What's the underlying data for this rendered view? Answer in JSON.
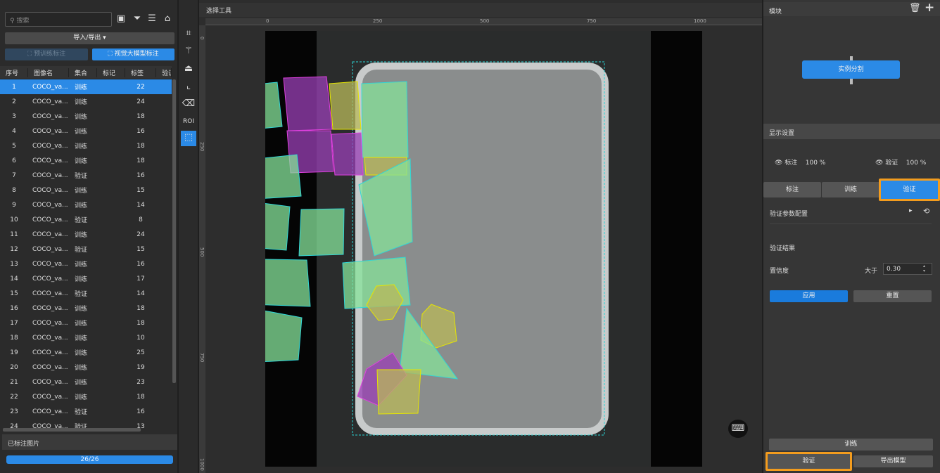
{
  "left_panel": {
    "search_placeholder": "搜索",
    "import_export": "导入/导出 ▾",
    "pretrain_label": "预训练标注",
    "vlm_label": "视觉大模型标注",
    "columns": [
      "序号",
      "图像名",
      "集合",
      "标记",
      "标签",
      "验证"
    ],
    "rows": [
      [
        "1",
        "COCO_va...",
        "训练",
        "",
        "22"
      ],
      [
        "2",
        "COCO_va...",
        "训练",
        "",
        "24"
      ],
      [
        "3",
        "COCO_va...",
        "训练",
        "",
        "18"
      ],
      [
        "4",
        "COCO_va...",
        "训练",
        "",
        "16"
      ],
      [
        "5",
        "COCO_va...",
        "训练",
        "",
        "18"
      ],
      [
        "6",
        "COCO_va...",
        "训练",
        "",
        "18"
      ],
      [
        "7",
        "COCO_va...",
        "验证",
        "",
        "16"
      ],
      [
        "8",
        "COCO_va...",
        "训练",
        "",
        "15"
      ],
      [
        "9",
        "COCO_va...",
        "训练",
        "",
        "14"
      ],
      [
        "10",
        "COCO_va...",
        "验证",
        "",
        "8"
      ],
      [
        "11",
        "COCO_va...",
        "训练",
        "",
        "24"
      ],
      [
        "12",
        "COCO_va...",
        "验证",
        "",
        "15"
      ],
      [
        "13",
        "COCO_va...",
        "训练",
        "",
        "16"
      ],
      [
        "14",
        "COCO_va...",
        "训练",
        "",
        "17"
      ],
      [
        "15",
        "COCO_va...",
        "验证",
        "",
        "14"
      ],
      [
        "16",
        "COCO_va...",
        "训练",
        "",
        "18"
      ],
      [
        "17",
        "COCO_va...",
        "训练",
        "",
        "18"
      ],
      [
        "18",
        "COCO_va...",
        "训练",
        "",
        "10"
      ],
      [
        "19",
        "COCO_va...",
        "训练",
        "",
        "25"
      ],
      [
        "20",
        "COCO_va...",
        "训练",
        "",
        "19"
      ],
      [
        "21",
        "COCO_va...",
        "训练",
        "",
        "23"
      ],
      [
        "22",
        "COCO_va...",
        "训练",
        "",
        "18"
      ],
      [
        "23",
        "COCO_va...",
        "验证",
        "",
        "16"
      ],
      [
        "24",
        "COCO_va...",
        "验证",
        "",
        "13"
      ]
    ],
    "selected_row": 0,
    "annotated_title": "已标注图片",
    "progress_text": "26/26",
    "progress": 1.0
  },
  "toolbar": {
    "roi_label": "ROI"
  },
  "center": {
    "title": "选择工具",
    "ruler_top": [
      "0",
      "250",
      "500",
      "750",
      "1000"
    ],
    "ruler_left": [
      "0",
      "250",
      "500",
      "750",
      "1000"
    ]
  },
  "right_panel": {
    "module_title": "模块",
    "module_node": "实例分割",
    "display_title": "显示设置",
    "annot_label": "标注",
    "annot_pct": "100 %",
    "verify_label": "验证",
    "verify_pct": "100 %",
    "tabs": [
      "标注",
      "训练",
      "验证"
    ],
    "active_tab": 2,
    "param_config": "验证参数配置",
    "result_title": "验证结果",
    "confidence_label": "置信度",
    "greater_than": "大于",
    "confidence_value": "0.30",
    "apply": "应用",
    "reset": "重置",
    "train": "训练",
    "verify": "验证",
    "export": "导出模型"
  },
  "colors": {
    "accent": "#2b8ae6",
    "highlight": "#f39c1e",
    "green_mask": "#86e39a",
    "purple_mask": "#9a3fb5",
    "yellow_mask": "#b8b85a"
  }
}
